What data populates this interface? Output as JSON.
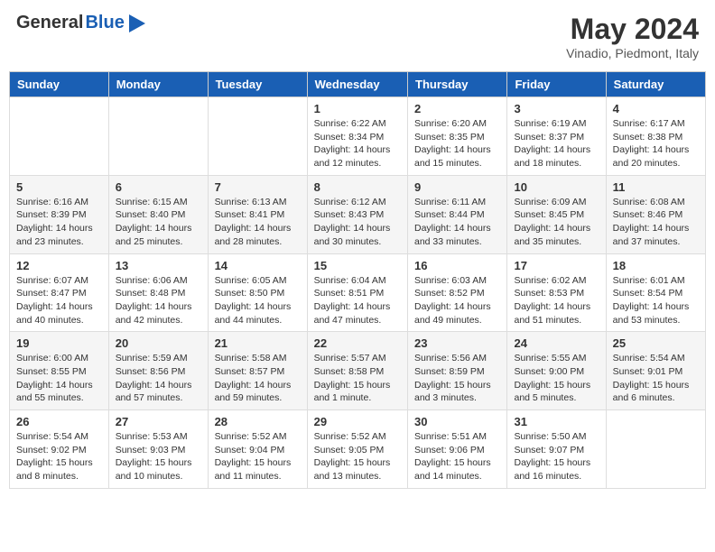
{
  "header": {
    "logo_general": "General",
    "logo_blue": "Blue",
    "month_title": "May 2024",
    "location": "Vinadio, Piedmont, Italy"
  },
  "days_of_week": [
    "Sunday",
    "Monday",
    "Tuesday",
    "Wednesday",
    "Thursday",
    "Friday",
    "Saturday"
  ],
  "weeks": [
    [
      {
        "day": "",
        "sunrise": "",
        "sunset": "",
        "daylight": ""
      },
      {
        "day": "",
        "sunrise": "",
        "sunset": "",
        "daylight": ""
      },
      {
        "day": "",
        "sunrise": "",
        "sunset": "",
        "daylight": ""
      },
      {
        "day": "1",
        "sunrise": "Sunrise: 6:22 AM",
        "sunset": "Sunset: 8:34 PM",
        "daylight": "Daylight: 14 hours and 12 minutes."
      },
      {
        "day": "2",
        "sunrise": "Sunrise: 6:20 AM",
        "sunset": "Sunset: 8:35 PM",
        "daylight": "Daylight: 14 hours and 15 minutes."
      },
      {
        "day": "3",
        "sunrise": "Sunrise: 6:19 AM",
        "sunset": "Sunset: 8:37 PM",
        "daylight": "Daylight: 14 hours and 18 minutes."
      },
      {
        "day": "4",
        "sunrise": "Sunrise: 6:17 AM",
        "sunset": "Sunset: 8:38 PM",
        "daylight": "Daylight: 14 hours and 20 minutes."
      }
    ],
    [
      {
        "day": "5",
        "sunrise": "Sunrise: 6:16 AM",
        "sunset": "Sunset: 8:39 PM",
        "daylight": "Daylight: 14 hours and 23 minutes."
      },
      {
        "day": "6",
        "sunrise": "Sunrise: 6:15 AM",
        "sunset": "Sunset: 8:40 PM",
        "daylight": "Daylight: 14 hours and 25 minutes."
      },
      {
        "day": "7",
        "sunrise": "Sunrise: 6:13 AM",
        "sunset": "Sunset: 8:41 PM",
        "daylight": "Daylight: 14 hours and 28 minutes."
      },
      {
        "day": "8",
        "sunrise": "Sunrise: 6:12 AM",
        "sunset": "Sunset: 8:43 PM",
        "daylight": "Daylight: 14 hours and 30 minutes."
      },
      {
        "day": "9",
        "sunrise": "Sunrise: 6:11 AM",
        "sunset": "Sunset: 8:44 PM",
        "daylight": "Daylight: 14 hours and 33 minutes."
      },
      {
        "day": "10",
        "sunrise": "Sunrise: 6:09 AM",
        "sunset": "Sunset: 8:45 PM",
        "daylight": "Daylight: 14 hours and 35 minutes."
      },
      {
        "day": "11",
        "sunrise": "Sunrise: 6:08 AM",
        "sunset": "Sunset: 8:46 PM",
        "daylight": "Daylight: 14 hours and 37 minutes."
      }
    ],
    [
      {
        "day": "12",
        "sunrise": "Sunrise: 6:07 AM",
        "sunset": "Sunset: 8:47 PM",
        "daylight": "Daylight: 14 hours and 40 minutes."
      },
      {
        "day": "13",
        "sunrise": "Sunrise: 6:06 AM",
        "sunset": "Sunset: 8:48 PM",
        "daylight": "Daylight: 14 hours and 42 minutes."
      },
      {
        "day": "14",
        "sunrise": "Sunrise: 6:05 AM",
        "sunset": "Sunset: 8:50 PM",
        "daylight": "Daylight: 14 hours and 44 minutes."
      },
      {
        "day": "15",
        "sunrise": "Sunrise: 6:04 AM",
        "sunset": "Sunset: 8:51 PM",
        "daylight": "Daylight: 14 hours and 47 minutes."
      },
      {
        "day": "16",
        "sunrise": "Sunrise: 6:03 AM",
        "sunset": "Sunset: 8:52 PM",
        "daylight": "Daylight: 14 hours and 49 minutes."
      },
      {
        "day": "17",
        "sunrise": "Sunrise: 6:02 AM",
        "sunset": "Sunset: 8:53 PM",
        "daylight": "Daylight: 14 hours and 51 minutes."
      },
      {
        "day": "18",
        "sunrise": "Sunrise: 6:01 AM",
        "sunset": "Sunset: 8:54 PM",
        "daylight": "Daylight: 14 hours and 53 minutes."
      }
    ],
    [
      {
        "day": "19",
        "sunrise": "Sunrise: 6:00 AM",
        "sunset": "Sunset: 8:55 PM",
        "daylight": "Daylight: 14 hours and 55 minutes."
      },
      {
        "day": "20",
        "sunrise": "Sunrise: 5:59 AM",
        "sunset": "Sunset: 8:56 PM",
        "daylight": "Daylight: 14 hours and 57 minutes."
      },
      {
        "day": "21",
        "sunrise": "Sunrise: 5:58 AM",
        "sunset": "Sunset: 8:57 PM",
        "daylight": "Daylight: 14 hours and 59 minutes."
      },
      {
        "day": "22",
        "sunrise": "Sunrise: 5:57 AM",
        "sunset": "Sunset: 8:58 PM",
        "daylight": "Daylight: 15 hours and 1 minute."
      },
      {
        "day": "23",
        "sunrise": "Sunrise: 5:56 AM",
        "sunset": "Sunset: 8:59 PM",
        "daylight": "Daylight: 15 hours and 3 minutes."
      },
      {
        "day": "24",
        "sunrise": "Sunrise: 5:55 AM",
        "sunset": "Sunset: 9:00 PM",
        "daylight": "Daylight: 15 hours and 5 minutes."
      },
      {
        "day": "25",
        "sunrise": "Sunrise: 5:54 AM",
        "sunset": "Sunset: 9:01 PM",
        "daylight": "Daylight: 15 hours and 6 minutes."
      }
    ],
    [
      {
        "day": "26",
        "sunrise": "Sunrise: 5:54 AM",
        "sunset": "Sunset: 9:02 PM",
        "daylight": "Daylight: 15 hours and 8 minutes."
      },
      {
        "day": "27",
        "sunrise": "Sunrise: 5:53 AM",
        "sunset": "Sunset: 9:03 PM",
        "daylight": "Daylight: 15 hours and 10 minutes."
      },
      {
        "day": "28",
        "sunrise": "Sunrise: 5:52 AM",
        "sunset": "Sunset: 9:04 PM",
        "daylight": "Daylight: 15 hours and 11 minutes."
      },
      {
        "day": "29",
        "sunrise": "Sunrise: 5:52 AM",
        "sunset": "Sunset: 9:05 PM",
        "daylight": "Daylight: 15 hours and 13 minutes."
      },
      {
        "day": "30",
        "sunrise": "Sunrise: 5:51 AM",
        "sunset": "Sunset: 9:06 PM",
        "daylight": "Daylight: 15 hours and 14 minutes."
      },
      {
        "day": "31",
        "sunrise": "Sunrise: 5:50 AM",
        "sunset": "Sunset: 9:07 PM",
        "daylight": "Daylight: 15 hours and 16 minutes."
      },
      {
        "day": "",
        "sunrise": "",
        "sunset": "",
        "daylight": ""
      }
    ]
  ]
}
